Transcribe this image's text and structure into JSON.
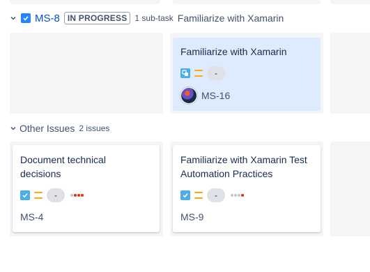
{
  "top_columns": 3,
  "swimlane": {
    "key": "MS-8",
    "status": "IN PROGRESS",
    "subtasks": "1 sub-task",
    "summary": "Familiarize with Xamarin",
    "cards": [
      {
        "title": "Familiarize with Xamarin",
        "type": "subtask-icon",
        "estimate": "-",
        "key": "MS-16",
        "has_avatar": true
      }
    ]
  },
  "other_issues": {
    "title": "Other Issues",
    "count": "2 issues",
    "cards": [
      {
        "title_line1": "Document technical",
        "title_line2": "decisions",
        "type": "task-checkbox-icon",
        "estimate": "-",
        "key": "MS-4"
      },
      {
        "title_line1": "Familiarize with Xamarin Test",
        "title_line2": "Automation Practices",
        "type": "task-checkbox-icon",
        "estimate": "-",
        "key": "MS-9"
      }
    ]
  },
  "colors": {
    "link": "#0052cc",
    "column_bg": "#f4f5f7",
    "selected_card": "#deebff",
    "priority_medium": "#ffab00",
    "checkbox_blue": "#2684ff",
    "dot_red": "#de350b"
  }
}
